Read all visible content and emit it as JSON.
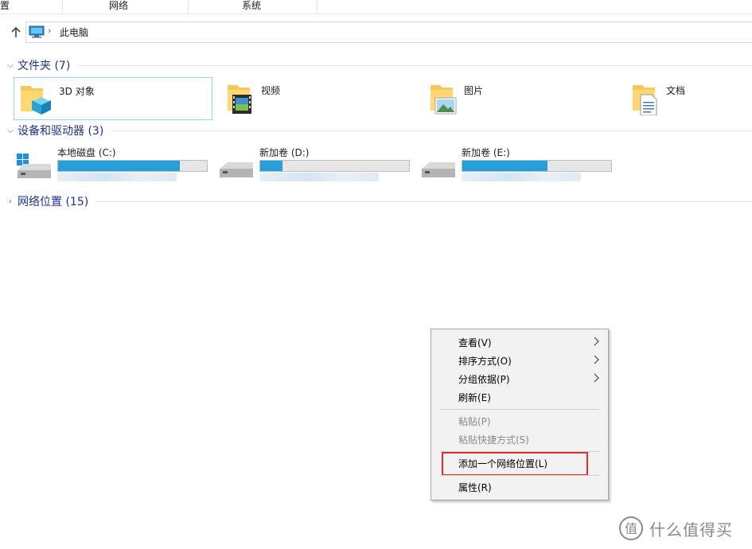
{
  "ribbon": {
    "tabs": [
      "置",
      "网络",
      "系统"
    ]
  },
  "address": {
    "crumb": "此电脑"
  },
  "groups": {
    "folders": {
      "title": "文件夹 (7)"
    },
    "devices": {
      "title": "设备和驱动器 (3)"
    },
    "network": {
      "title": "网络位置 (15)"
    }
  },
  "folders": [
    {
      "name": "3D 对象",
      "icon": "3d-objects-folder-icon"
    },
    {
      "name": "视频",
      "icon": "videos-folder-icon"
    },
    {
      "name": "图片",
      "icon": "pictures-folder-icon"
    },
    {
      "name": "文档",
      "icon": "documents-folder-icon"
    }
  ],
  "drives": [
    {
      "name": "本地磁盘 (C:)",
      "used_fraction": 0.82,
      "icon": "windows-drive-icon"
    },
    {
      "name": "新加卷 (D:)",
      "used_fraction": 0.15,
      "icon": "hard-drive-icon"
    },
    {
      "name": "新加卷 (E:)",
      "used_fraction": 0.57,
      "icon": "hard-drive-icon"
    }
  ],
  "context_menu": {
    "view": "查看(V)",
    "sort": "排序方式(O)",
    "group": "分组依据(P)",
    "refresh": "刷新(E)",
    "paste": "粘贴(P)",
    "paste_shortcut": "粘贴快捷方式(S)",
    "add_network_location": "添加一个网络位置(L)",
    "properties": "属性(R)"
  },
  "colors": {
    "accent": "#26a0da",
    "highlight_box": "#d9332e",
    "group_title": "#1e3287"
  },
  "watermark": {
    "text": "什么值得买"
  }
}
